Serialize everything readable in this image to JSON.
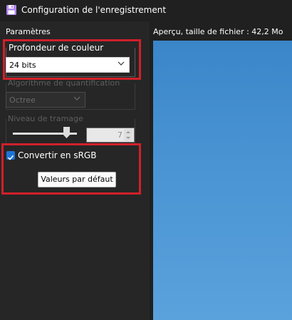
{
  "window": {
    "title": "Configuration de l'enregistrement",
    "icon": "floppy-disk-icon"
  },
  "left_panel": {
    "section_label": "Paramètres",
    "color_depth": {
      "label": "Profondeur de couleur",
      "selected": "24 bits"
    },
    "quantization": {
      "label": "Algorithme de quantification",
      "selected": "Octree",
      "enabled": false
    },
    "dithering": {
      "label": "Niveau de tramage",
      "value": "7",
      "slider_level": 0.85,
      "enabled": false
    },
    "convert_srgb": {
      "label": "Convertir en sRGB",
      "checked": true
    },
    "defaults_button": "Valeurs par défaut"
  },
  "preview": {
    "label": "Aperçu, taille de fichier : 42,2 Mo"
  },
  "colors": {
    "background": "#202020",
    "panel": "#262626",
    "accent": "#1e73d8",
    "highlight": "#d0202a",
    "preview_sky": "#4a94d4"
  }
}
